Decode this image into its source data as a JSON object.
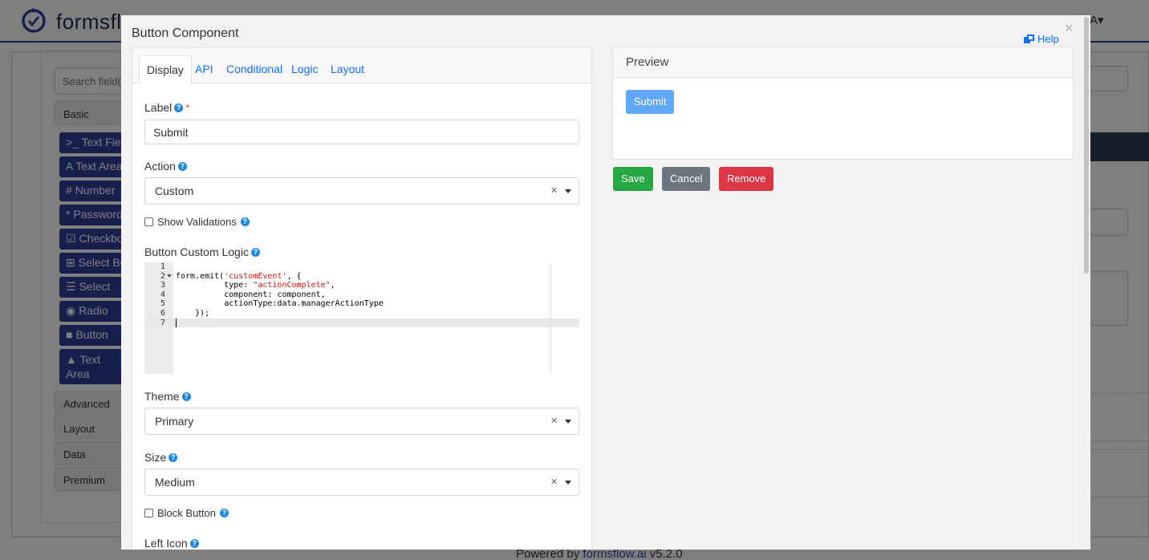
{
  "background": {
    "brand": "formsflo",
    "search_placeholder": "Search field(s)",
    "groups": [
      "Basic",
      "Advanced",
      "Layout",
      "Data",
      "Premium"
    ],
    "basic_items": [
      {
        "icon": ">_",
        "label": "Text Field"
      },
      {
        "icon": "A",
        "label": "Text Area"
      },
      {
        "icon": "#",
        "label": "Number"
      },
      {
        "icon": "*",
        "label": "Password"
      },
      {
        "icon": "☑",
        "label": "Checkbox"
      },
      {
        "icon": "⊞",
        "label": "Select Boxes"
      },
      {
        "icon": "☰",
        "label": "Select"
      },
      {
        "icon": "◉",
        "label": "Radio"
      },
      {
        "icon": "■",
        "label": "Button"
      },
      {
        "icon": "▲",
        "label": "Text Area Analytics"
      }
    ],
    "footer_prefix": "Powered by ",
    "footer_link": "formsflow.ai",
    "footer_version": " v5.2.0"
  },
  "modal": {
    "title": "Button Component",
    "help": "Help",
    "tabs": [
      "Display",
      "API",
      "Conditional",
      "Logic",
      "Layout"
    ],
    "active_tab": "Display",
    "fields": {
      "label": {
        "label": "Label",
        "value": "Submit"
      },
      "action": {
        "label": "Action",
        "value": "Custom"
      },
      "show_validations": {
        "label": "Show Validations",
        "checked": false
      },
      "custom_logic": {
        "label": "Button Custom Logic",
        "lines": [
          "",
          "form.emit('customEvent', {",
          "          type: \"actionComplete\",",
          "          component: component,",
          "          actionType:data.managerActionType",
          "    });",
          ""
        ]
      },
      "theme": {
        "label": "Theme",
        "value": "Primary"
      },
      "size": {
        "label": "Size",
        "value": "Medium"
      },
      "block_button": {
        "label": "Block Button",
        "checked": false
      },
      "left_icon": {
        "label": "Left Icon"
      }
    },
    "preview": {
      "title": "Preview",
      "button": "Submit"
    },
    "buttons": {
      "save": "Save",
      "cancel": "Cancel",
      "remove": "Remove"
    },
    "colors": {
      "save": "#28a745",
      "cancel": "#6c757d",
      "remove": "#dc3545",
      "link": "#0d6efd",
      "preview_button": "#5fa8f7"
    }
  }
}
